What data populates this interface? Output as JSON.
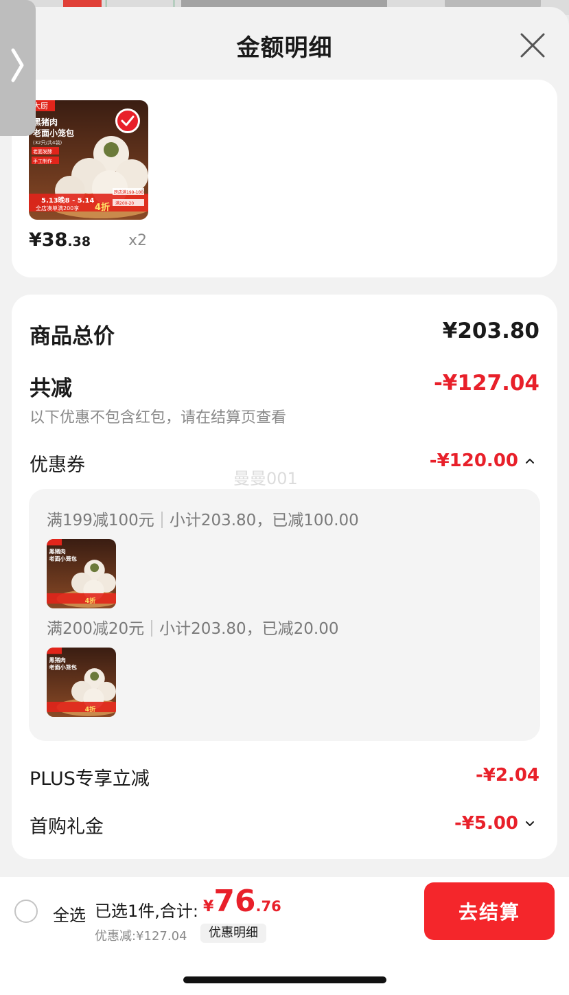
{
  "header": {
    "title": "金额明细"
  },
  "product": {
    "price_main": "¥38",
    "price_decimal": ".38",
    "quantity": "x2",
    "image_icon": "steamed-bun-product-image",
    "image_texts": [
      "大厨",
      "黑猪肉",
      "老面小笼包",
      "(32只/共4袋)",
      "老面发酵",
      "手工制作",
      "5.13晚8 - 5.14",
      "全店凑单满200享",
      "4折",
      "跨店满199-100",
      "满200-20"
    ]
  },
  "summary": {
    "total_label": "商品总价",
    "total_value": "¥203.80",
    "reduce_label": "共减",
    "reduce_value": "-¥127.04",
    "note": "以下优惠不包含红包，请在结算页查看",
    "coupon_label": "优惠券",
    "coupon_value": "-¥120.00",
    "watermark": "曼曼001",
    "coupons": [
      {
        "rule": "满199减100元",
        "detail": "小计203.80，已减100.00"
      },
      {
        "rule": "满200减20元",
        "detail": "小计203.80，已减20.00"
      }
    ],
    "plus_label": "PLUS专享立减",
    "plus_value": "-¥2.04",
    "gift_label": "首购礼金",
    "gift_value": "-¥5.00"
  },
  "footer": {
    "select_all": "全选",
    "selected_info": "已选1件,合计:",
    "total_yen": "¥",
    "total_main": "76",
    "total_decimal": ".76",
    "discount_info": "优惠减:¥127.04",
    "detail_chip": "优惠明细",
    "checkout": "去结算"
  },
  "colors": {
    "accent": "#e8202a",
    "checkout": "#f4262b",
    "muted": "#8a8a8a"
  }
}
